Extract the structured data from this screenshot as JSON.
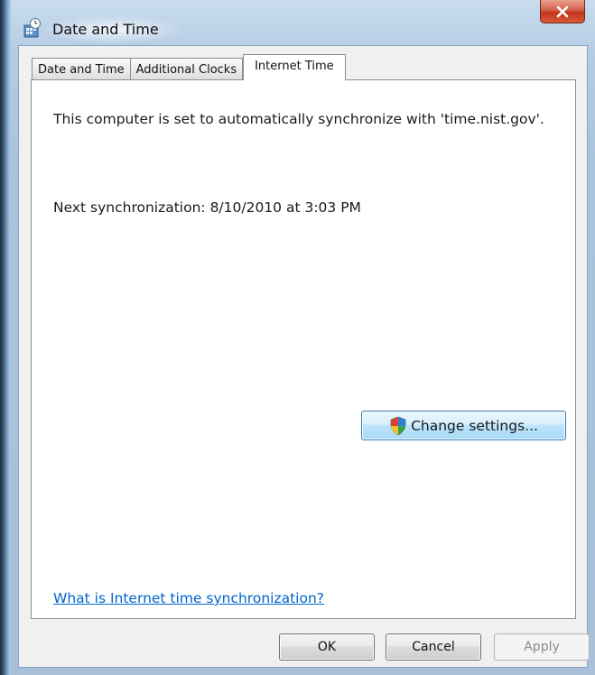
{
  "window": {
    "title": "Date and Time",
    "icon": "date-time-control-panel-icon",
    "close_icon": "close-icon"
  },
  "tabs": [
    {
      "label": "Date and Time",
      "active": false
    },
    {
      "label": "Additional Clocks",
      "active": false
    },
    {
      "label": "Internet Time",
      "active": true
    }
  ],
  "internet_time": {
    "sync_message": "This computer is set to automatically synchronize with 'time.nist.gov'.",
    "next_sync": "Next synchronization: 8/10/2010 at 3:03 PM",
    "change_settings_label": "Change settings...",
    "change_settings_icon": "uac-shield-icon",
    "help_link": "What is Internet time synchronization?"
  },
  "buttons": {
    "ok": "OK",
    "cancel": "Cancel",
    "apply": "Apply",
    "apply_enabled": false
  },
  "colors": {
    "link": "#0066cc",
    "close_button": "#c2361c",
    "focus_button": "#a7d9f5"
  }
}
